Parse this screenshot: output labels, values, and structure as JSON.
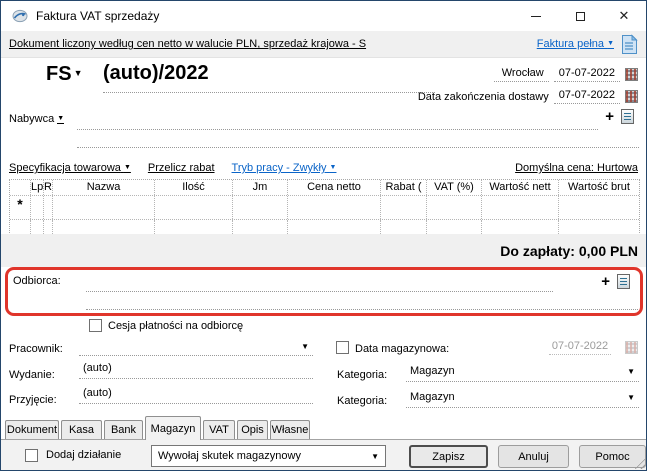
{
  "window": {
    "title": "Faktura VAT sprzedaży",
    "close_glyph": "✕"
  },
  "infobar": {
    "document_summary": "Dokument liczony według cen netto w walucie PLN, sprzedaż krajowa - S",
    "invoice_type_link": "Faktura pełna"
  },
  "header": {
    "doc_type": "FS",
    "doc_number": "(auto)/2022",
    "city": "Wrocław",
    "issue_date": "07-07-2022",
    "delivery_date_label": "Data zakończenia dostawy",
    "delivery_date": "07-07-2022",
    "buyer_label": "Nabywca",
    "plus_glyph": "+"
  },
  "grid_toolbar": {
    "spec_link": "Specyfikacja towarowa",
    "recalc_link": "Przelicz rabat",
    "mode_link": "Tryb pracy - Zwykły",
    "default_price": "Domyślna cena: Hurtowa"
  },
  "items_table": {
    "columns": [
      "",
      "Lp",
      "R",
      "Nazwa",
      "Ilość",
      "Jm",
      "Cena netto",
      "Rabat (",
      "VAT (%)",
      "Wartość nett",
      "Wartość brut"
    ],
    "new_row_marker": "*"
  },
  "summary": {
    "total_due": "Do zapłaty: 0,00 PLN"
  },
  "recipient": {
    "label": "Odbiorca:",
    "plus_glyph": "+",
    "cession_label": "Cesja płatności na odbiorcę",
    "highlight_color": "#e0352b"
  },
  "form": {
    "employee_label": "Pracownik:",
    "issue_label": "Wydanie:",
    "issue_value": "(auto)",
    "receipt_label": "Przyjęcie:",
    "receipt_value": "(auto)",
    "warehouse_date_label": "Data magazynowa:",
    "warehouse_date": "07-07-2022",
    "category1_label": "Kategoria:",
    "category1_value": "Magazyn",
    "category2_label": "Kategoria:",
    "category2_value": "Magazyn"
  },
  "tabs": [
    "Dokument",
    "Kasa",
    "Bank",
    "Magazyn",
    "VAT",
    "Opis",
    "Własne"
  ],
  "active_tab": "Magazyn",
  "footer": {
    "add_action_label": "Dodaj działanie",
    "action_combo_value": "Wywołaj skutek magazynowy",
    "save_label": "Zapisz",
    "cancel_label": "Anuluj",
    "help_label": "Pomoc"
  },
  "colors": {
    "accent_red": "#e0352b",
    "link_blue": "#0a64c8"
  }
}
